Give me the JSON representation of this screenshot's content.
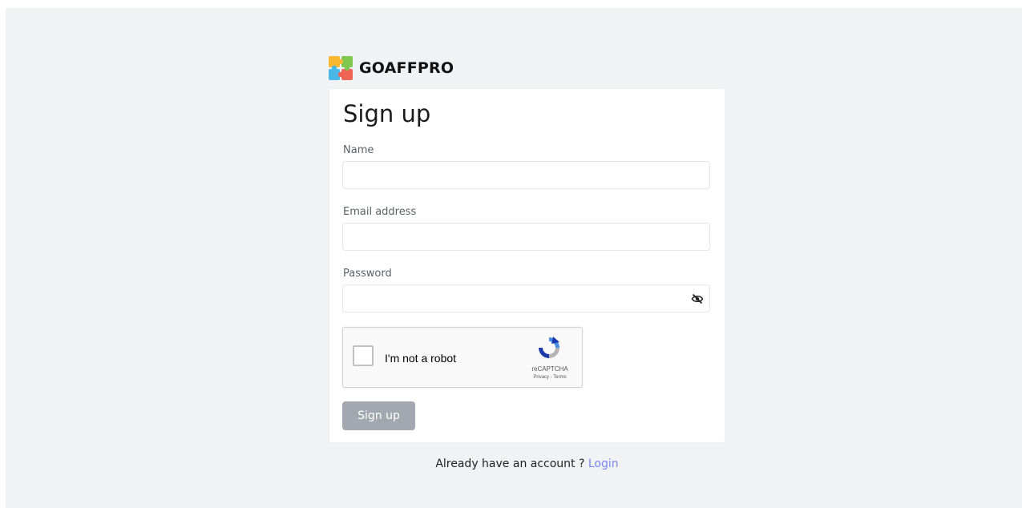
{
  "brand": {
    "name": "GOAFFPRO",
    "logo_colors": [
      "#f7b731",
      "#7ec850",
      "#48b8e8",
      "#f06455"
    ]
  },
  "form": {
    "title": "Sign up",
    "name_label": "Name",
    "name_value": "",
    "email_label": "Email address",
    "email_value": "",
    "password_label": "Password",
    "password_value": "",
    "password_toggle_icon": "eye-slash-icon",
    "captcha": {
      "label": "I'm not a robot",
      "checked": false,
      "brand": "reCAPTCHA",
      "links": "Privacy - Terms"
    },
    "submit_label": "Sign up",
    "submit_enabled": false
  },
  "footer": {
    "text": "Already have an account ? ",
    "link_label": "Login"
  },
  "colors": {
    "background": "#f1f2f4",
    "link": "#7a87f5",
    "button_disabled": "#a3a8b0"
  }
}
